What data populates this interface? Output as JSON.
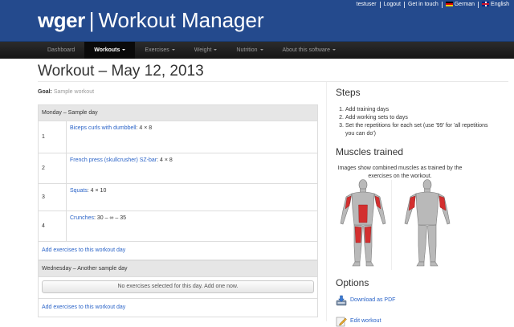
{
  "header": {
    "brand": "wger",
    "separator": "|",
    "app_name": "Workout Manager",
    "links": {
      "user": "testuser",
      "logout": "Logout",
      "contact": "Get in touch",
      "german": "German",
      "english": "English"
    }
  },
  "nav": {
    "items": [
      {
        "label": "Dashboard",
        "dropdown": false,
        "active": false
      },
      {
        "label": "Workouts",
        "dropdown": true,
        "active": true
      },
      {
        "label": "Exercises",
        "dropdown": true,
        "active": false
      },
      {
        "label": "Weight",
        "dropdown": true,
        "active": false
      },
      {
        "label": "Nutrition",
        "dropdown": true,
        "active": false
      },
      {
        "label": "About this software",
        "dropdown": true,
        "active": false
      }
    ]
  },
  "page": {
    "title": "Workout – May 12, 2013",
    "goal_label": "Goal:",
    "goal_value": "Sample workout"
  },
  "days": [
    {
      "title": "Monday – Sample day",
      "exercises": [
        {
          "num": "1",
          "name": "Biceps curls with dumbbell",
          "sets": ": 4 × 8"
        },
        {
          "num": "2",
          "name": "French press (skullcrusher) SZ-bar",
          "sets": ": 4 × 8"
        },
        {
          "num": "3",
          "name": "Squats",
          "sets": ": 4 × 10"
        },
        {
          "num": "4",
          "name": "Crunches",
          "sets": ": 30 – ∞ – 35"
        }
      ],
      "add_link": "Add exercises to this workout day"
    },
    {
      "title": "Wednesday – Another sample day",
      "empty_message": "No exercises selected for this day. Add one now.",
      "add_link": "Add exercises to this workout day"
    }
  ],
  "sidebar": {
    "steps_title": "Steps",
    "steps": [
      {
        "num": "1.",
        "text": "Add training days"
      },
      {
        "num": "2.",
        "text": "Add working sets to days"
      },
      {
        "num": "3.",
        "text": "Set the repetitions for each set (use '99' for 'all repetitions you can do')"
      }
    ],
    "muscles_title": "Muscles trained",
    "muscles_text": "Images show combined muscles as trained by the exercises on the workout.",
    "options_title": "Options",
    "options": [
      {
        "label": "Download as PDF",
        "icon": "pdf-download-icon"
      },
      {
        "label": "Edit workout",
        "icon": "edit-icon"
      }
    ]
  },
  "colors": {
    "header_bg": "#244a8d",
    "navbar_bg": "#1b1b1b",
    "link": "#2b64c8",
    "muscle_highlight": "#d32f2f"
  }
}
